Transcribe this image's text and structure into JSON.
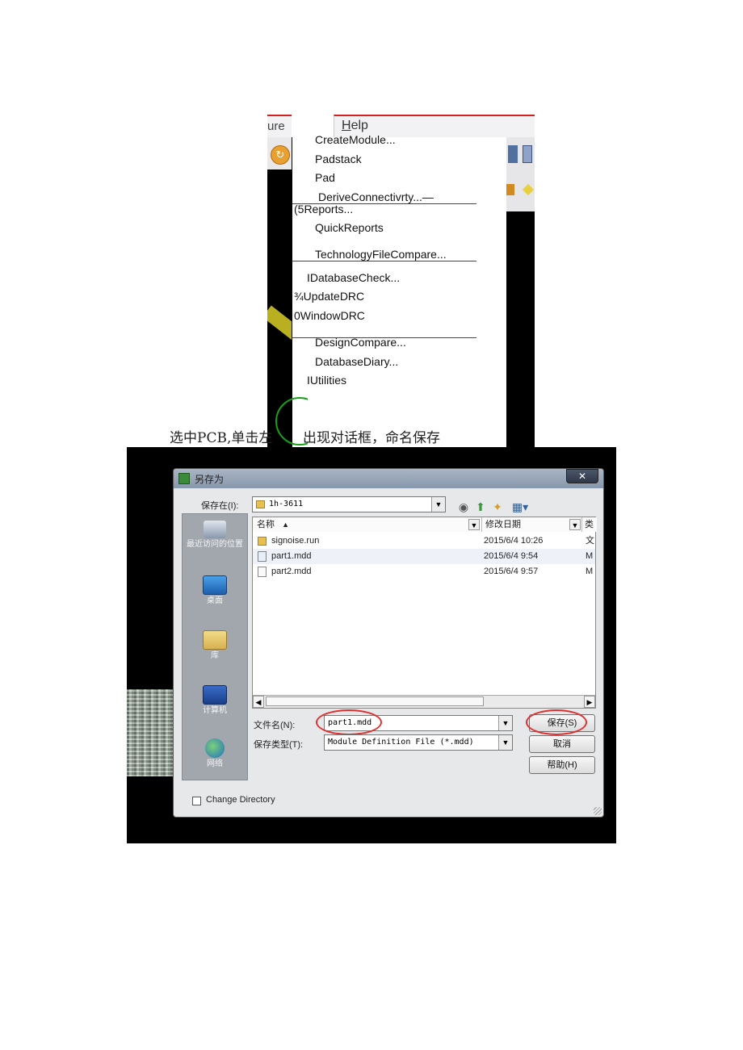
{
  "menu_screenshot": {
    "partial_menu_label": "ure",
    "help_menu": {
      "label_first": "H",
      "label_rest": "elp"
    },
    "items": [
      "CreateModule...",
      "Padstack",
      "Pad",
      "DeriveConnectivrty...—",
      "(5Reports...",
      "QuickReports",
      "TechnologyFileCompare...",
      "IDatabaseCheck...",
      "¾UpdateDRC",
      "0WindowDRC",
      "DesignCompare...",
      "DatabaseDiary...",
      "IUtilities"
    ]
  },
  "caption": {
    "part1": "选中PCB,单击左",
    "part2": "出现对话框，命名保存"
  },
  "dialog": {
    "title": "另存为",
    "close_label": "✕",
    "save_in_label": "保存在(I):",
    "save_in_value": "1h-3611",
    "places": [
      "最近访问的位置",
      "桌面",
      "库",
      "计算机",
      "网络"
    ],
    "columns": {
      "name": "名称",
      "date": "修改日期",
      "type": "类"
    },
    "files": [
      {
        "name": "signoise.run",
        "date": "2015/6/4 10:26",
        "type": "文",
        "icon": "folder-icon"
      },
      {
        "name": "part1.mdd",
        "date": "2015/6/4 9:54",
        "type": "M",
        "icon": "file-icon"
      },
      {
        "name": "part2.mdd",
        "date": "2015/6/4 9:57",
        "type": "M",
        "icon": "file-icon"
      }
    ],
    "filename_label": "文件名(N):",
    "filename_value": "part1.mdd",
    "filetype_label": "保存类型(T):",
    "filetype_value": "Module Definition File (*.mdd)",
    "save_button": "保存(S)",
    "cancel_button": "取消",
    "help_button": "帮助(H)",
    "change_directory_label": "Change Directory"
  },
  "colors": {
    "menu_accent": "#d02020",
    "annotation_ring": "#e03030",
    "titlebar": "#8797ab"
  }
}
